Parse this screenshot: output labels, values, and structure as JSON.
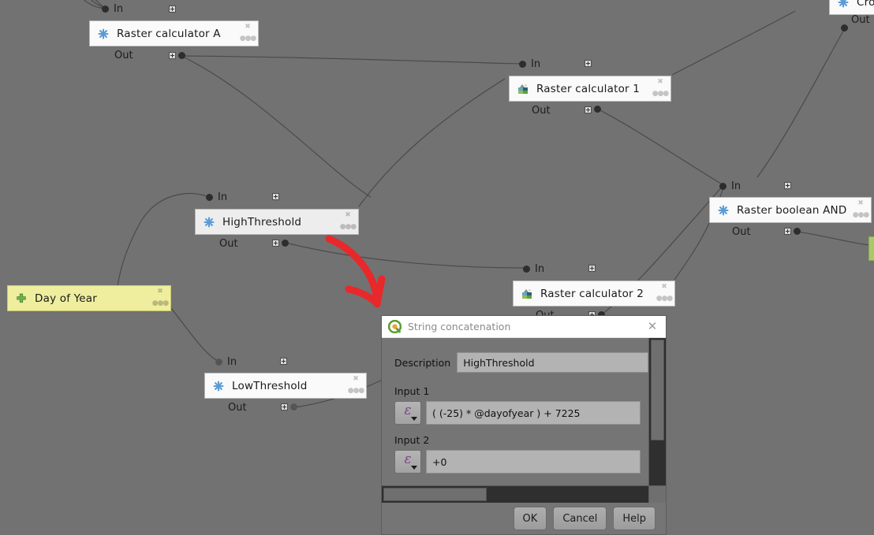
{
  "canvas": {
    "background_color": "#727272",
    "nodes": [
      {
        "id": "crop",
        "label": "Crop",
        "icon": "asterisk-icon",
        "kind": "algorithm",
        "in_label": "",
        "out_label": "Out",
        "clipped": true
      },
      {
        "id": "raster-calculator-a",
        "label": "Raster calculator A",
        "icon": "asterisk-icon",
        "kind": "algorithm",
        "in_label": "In",
        "out_label": "Out"
      },
      {
        "id": "raster-calculator-1",
        "label": "Raster calculator 1",
        "icon": "raster-icon",
        "kind": "algorithm",
        "in_label": "In",
        "out_label": "Out"
      },
      {
        "id": "raster-boolean-and",
        "label": "Raster boolean AND",
        "icon": "asterisk-icon",
        "kind": "algorithm",
        "in_label": "In",
        "out_label": "Out"
      },
      {
        "id": "high-threshold",
        "label": "HighThreshold",
        "icon": "asterisk-icon",
        "kind": "algorithm",
        "selected": true,
        "in_label": "In",
        "out_label": "Out"
      },
      {
        "id": "day-of-year",
        "label": "Day of Year",
        "icon": "plus-icon",
        "kind": "parameter",
        "color": "#eeee9e"
      },
      {
        "id": "raster-calculator-2",
        "label": "Raster calculator 2",
        "icon": "raster-icon",
        "kind": "algorithm",
        "in_label": "In",
        "out_label": "Out"
      },
      {
        "id": "low-threshold",
        "label": "LowThreshold",
        "icon": "asterisk-icon",
        "kind": "algorithm",
        "in_label": "In",
        "out_label": "Out"
      }
    ],
    "annotation": {
      "type": "arrow",
      "color": "#e8282a",
      "points_to": "high-threshold-out-port"
    }
  },
  "dialog": {
    "title": "String concatenation",
    "logo": "qgis-logo-icon",
    "close_label": "✕",
    "description_label": "Description",
    "description_value": "HighThreshold",
    "inputs": [
      {
        "label": "Input 1",
        "expression_button": "expression-icon",
        "value": "( (-25) * @dayofyear )  + 7225"
      },
      {
        "label": "Input 2",
        "expression_button": "expression-icon",
        "value": "+0"
      }
    ],
    "buttons": {
      "ok": "OK",
      "cancel": "Cancel",
      "help": "Help"
    }
  }
}
